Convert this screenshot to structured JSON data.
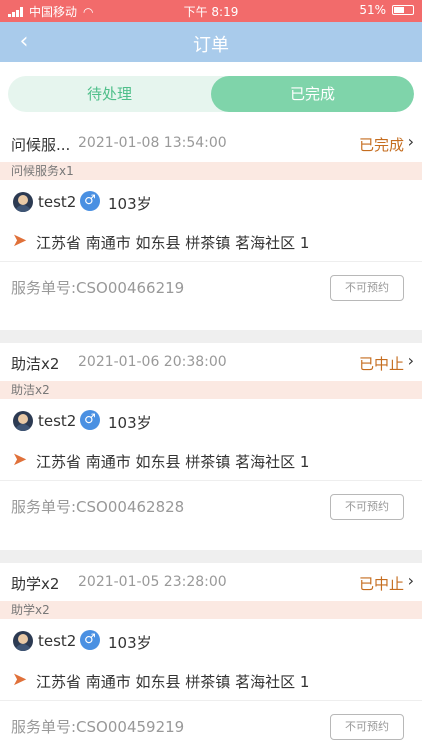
{
  "status": {
    "carrier": "中国移动",
    "time": "下午 8:19",
    "battery": "51%"
  },
  "header": {
    "back": "‹",
    "title": "订单"
  },
  "tabs": [
    {
      "label": "待处理"
    },
    {
      "label": "已完成"
    }
  ],
  "orders": [
    {
      "service": "问候服...",
      "time": "2021-01-08 13:54:00",
      "state": "已完成",
      "items": "问候服务x1",
      "user": "test2",
      "gender": "♂",
      "age": "103岁",
      "address": "江苏省 南通市 如东县 栟茶镇 茗海社区 1",
      "order_no": "服务单号:CSO00466219",
      "action": "不可预约"
    },
    {
      "service": "助洁x2",
      "time": "2021-01-06 20:38:00",
      "state": "已中止",
      "items": "助洁x2",
      "user": "test2",
      "gender": "♂",
      "age": "103岁",
      "address": "江苏省 南通市 如东县 栟茶镇 茗海社区 1",
      "order_no": "服务单号:CSO00462828",
      "action": "不可预约"
    },
    {
      "service": "助学x2",
      "time": "2021-01-05 23:28:00",
      "state": "已中止",
      "items": "助学x2",
      "user": "test2",
      "gender": "♂",
      "age": "103岁",
      "address": "江苏省 南通市 如东县 栟茶镇 茗海社区 1",
      "order_no": "服务单号:CSO00459219",
      "action": "不可预约"
    }
  ]
}
